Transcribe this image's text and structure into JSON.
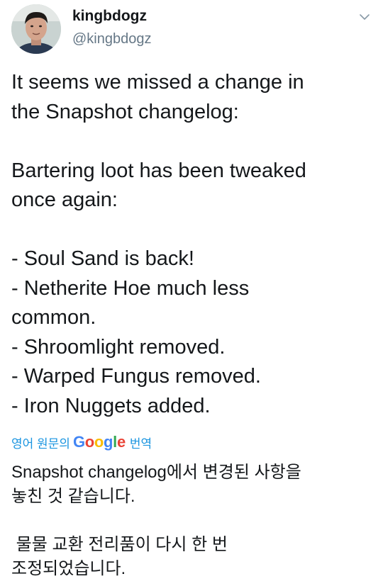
{
  "user": {
    "display_name": "kingbdogz",
    "handle": "@kingbdogz"
  },
  "tweet": {
    "lines": [
      "It seems we missed a change in",
      "the Snapshot changelog:",
      "",
      "Bartering loot has been tweaked",
      "once again:",
      "",
      "- Soul Sand is back!",
      "- Netherite Hoe much less",
      "common.",
      "- Shroomlight removed.",
      "- Warped Fungus removed.",
      "- Iron Nuggets added."
    ]
  },
  "translate_bar": {
    "prefix": "영어 원문의",
    "google_letters": [
      "G",
      "o",
      "o",
      "g",
      "l",
      "e"
    ],
    "suffix": "번역"
  },
  "translation": {
    "lines": [
      "Snapshot changelog에서 변경된 사항을",
      "놓친 것 같습니다.",
      "",
      " 물물 교환 전리품이 다시 한 번",
      "조정되었습니다."
    ]
  },
  "icons": {
    "avatar": "user-avatar-photo",
    "caret": "chevron-down-icon"
  },
  "colors": {
    "text": "#14171a",
    "secondary": "#657786",
    "link": "#1b95e0"
  }
}
